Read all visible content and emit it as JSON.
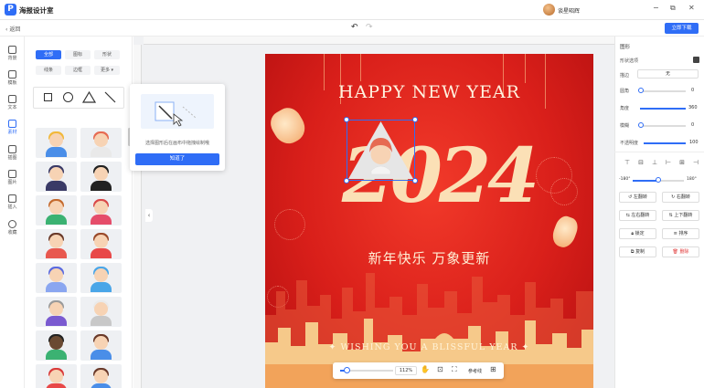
{
  "app": {
    "title": "海报设计室",
    "logo_letter": "P",
    "username": "谈星昭辉"
  },
  "window_controls": {
    "minimize": "−",
    "restore": "⧉",
    "close": "✕"
  },
  "subbar": {
    "back": "返回",
    "undo": "↶",
    "redo": "↷",
    "download": "立即下载"
  },
  "rail": [
    {
      "label": "背景",
      "icon": "background-icon"
    },
    {
      "label": "模板",
      "icon": "template-icon"
    },
    {
      "label": "文本",
      "icon": "text-icon"
    },
    {
      "label": "素材",
      "icon": "material-icon",
      "active": true
    },
    {
      "label": "插图",
      "icon": "illustration-icon"
    },
    {
      "label": "图片",
      "icon": "image-icon"
    },
    {
      "label": "插入",
      "icon": "insert-icon"
    },
    {
      "label": "收藏",
      "icon": "favorite-icon"
    }
  ],
  "panel": {
    "chips_row1": [
      "全部",
      "图标",
      "形状"
    ],
    "chips_row2": [
      "线条",
      "边框",
      "更多 ▾"
    ],
    "active_chip": "全部",
    "shapes": [
      "□",
      "○",
      "△",
      "╲"
    ]
  },
  "popover": {
    "text": "选择图形后在画布中拖拽绘制哦",
    "button": "知道了"
  },
  "poster": {
    "headline": "HAPPY NEW YEAR",
    "year": "2024",
    "cn_title": "新年快乐  万象更新",
    "wishing": "✦ WISHING YOU A BLISSFUL YEAR ✦"
  },
  "zoombar": {
    "value": "112%",
    "hand_icon": "✋",
    "fit_icon": "⊡",
    "fullscreen_icon": "⛶",
    "guides_label": "参考线",
    "guides_icon": "⊞",
    "progress": 0.12
  },
  "props": {
    "title": "图形",
    "fill_label": "形状选项",
    "border_label": "描边",
    "border_value": "无",
    "radius_label": "圆角",
    "radius_value": "0",
    "angle_label": "角度",
    "angle_value": "360",
    "blur_label": "模糊",
    "blur_value": "0",
    "opacity_label": "不透明度",
    "opacity_value": "100",
    "rotate_min": "-180°",
    "rotate_max": "180°",
    "buttons": [
      "左翻转",
      "右翻转",
      "左右翻转",
      "上下翻转",
      "锁定",
      "排序",
      "复制",
      "删除"
    ]
  },
  "colors": {
    "accent": "#2f6df6",
    "poster_red": "#d91f1a",
    "year_cream": "#fbe0b6"
  }
}
